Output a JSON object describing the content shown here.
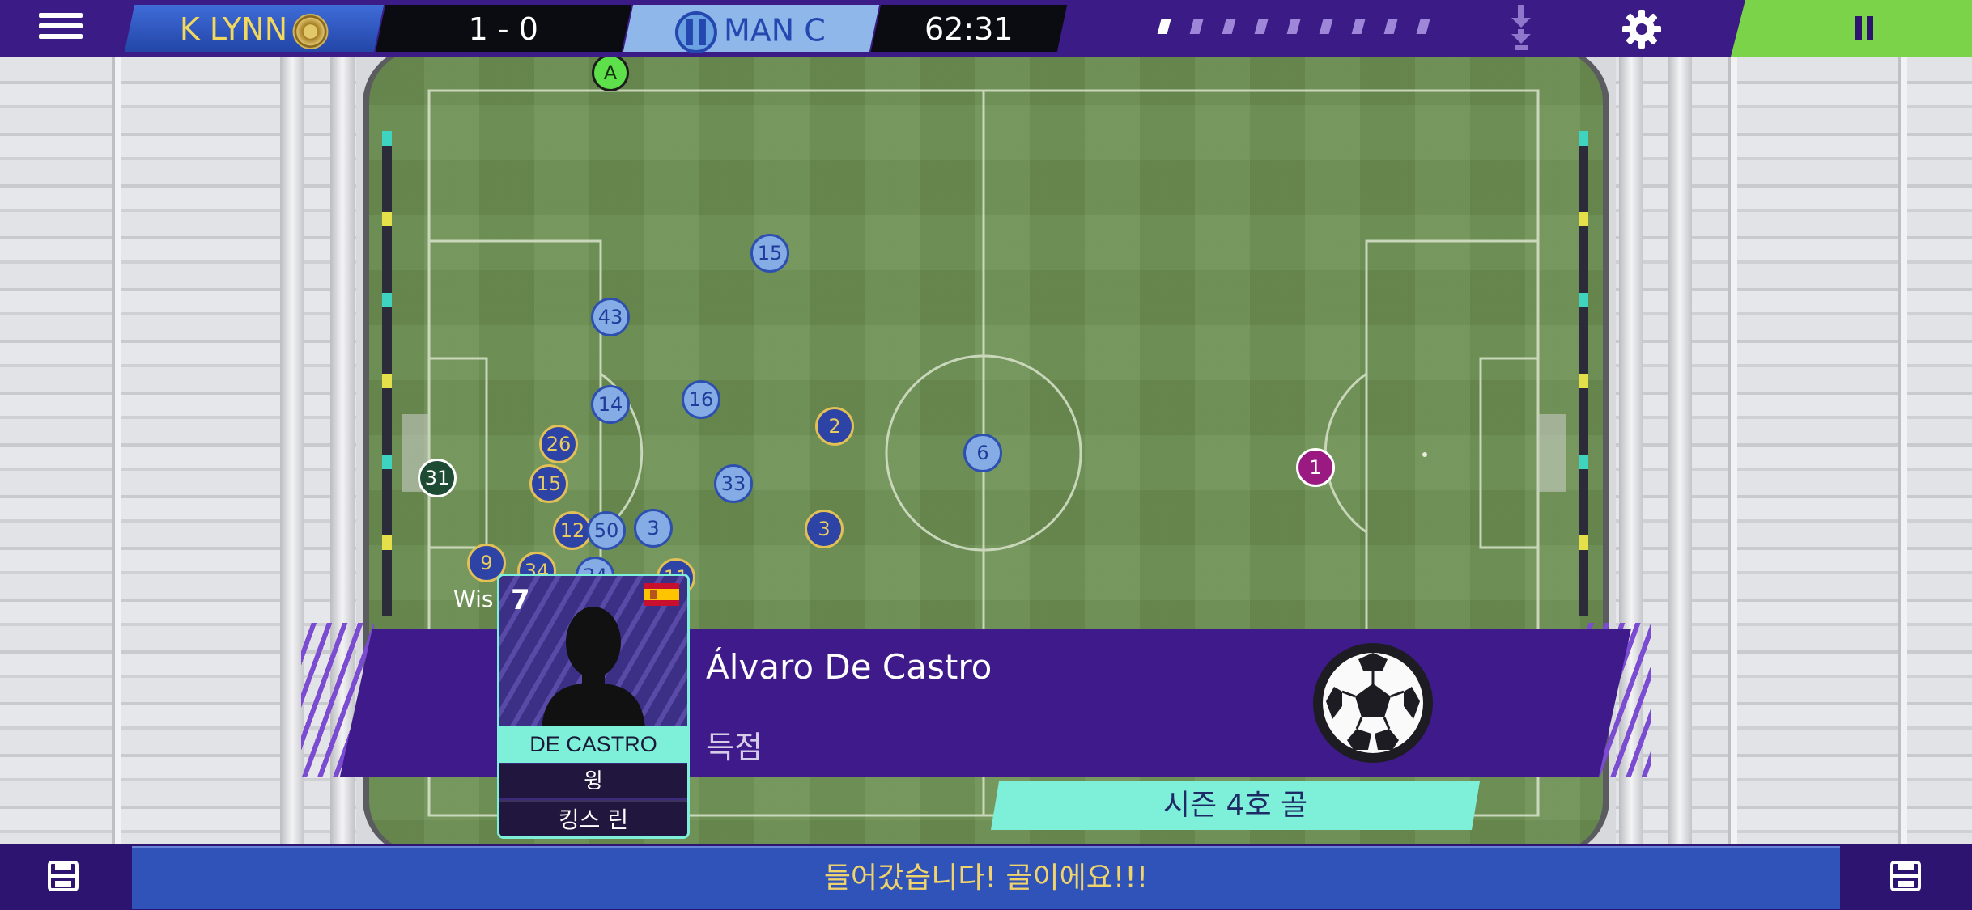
{
  "match": {
    "home_team": "K LYNN",
    "score": "1 - 0",
    "away_team": "MAN C",
    "clock": "62:31",
    "home_color": "#2346a8",
    "away_color": "#8fb7ea",
    "progress_segments_total": 9,
    "progress_segments_done": 1
  },
  "icons": {
    "menu": "hamburger-icon",
    "substitution": "substitution-arrows-icon",
    "settings": "gear-icon",
    "pause": "pause-icon",
    "save_left": "tactics-icon",
    "save_right": "tactics-icon"
  },
  "players": [
    {
      "num": "15",
      "team": "away"
    },
    {
      "num": "43",
      "team": "away"
    },
    {
      "num": "14",
      "team": "away"
    },
    {
      "num": "16",
      "team": "away"
    },
    {
      "num": "26",
      "team": "home"
    },
    {
      "num": "15",
      "team": "home"
    },
    {
      "num": "31",
      "team": "gk"
    },
    {
      "num": "33",
      "team": "away"
    },
    {
      "num": "2",
      "team": "home"
    },
    {
      "num": "6",
      "team": "away"
    },
    {
      "num": "1",
      "team": "awaygk"
    },
    {
      "num": "12",
      "team": "home"
    },
    {
      "num": "50",
      "team": "away"
    },
    {
      "num": "3",
      "team": "away"
    },
    {
      "num": "3",
      "team": "home"
    },
    {
      "num": "9",
      "team": "home"
    },
    {
      "num": "34",
      "team": "home"
    },
    {
      "num": "34",
      "team": "away"
    },
    {
      "num": "11",
      "team": "home"
    },
    {
      "num": "A",
      "team": "ref"
    }
  ],
  "goal_event": {
    "scorer": "Álvaro De Castro",
    "event": "득점",
    "season_goal": "시즌 4호 골",
    "overlay_text": "Wis"
  },
  "player_card": {
    "number": "7",
    "name": "DE CASTRO",
    "position": "윙",
    "club": "킹스 린",
    "nationality_flag": "spain-flag-icon"
  },
  "commentary": "들어갔습니다! 골이에요!!!"
}
